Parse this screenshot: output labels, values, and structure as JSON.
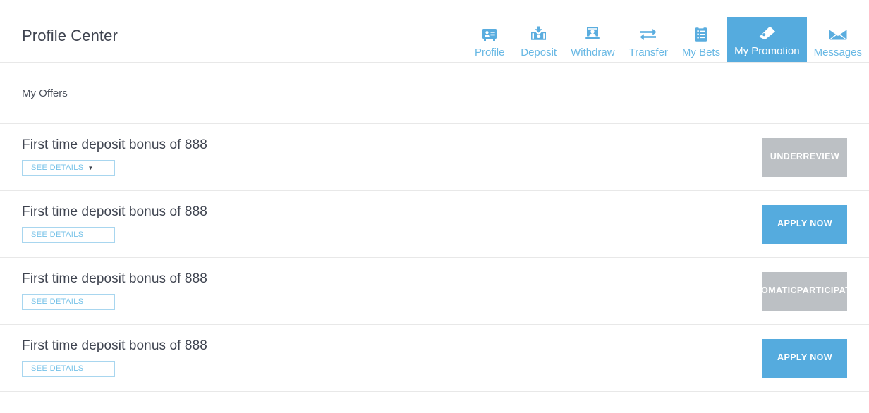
{
  "header": {
    "title": "Profile Center",
    "nav_items": [
      {
        "label": "Profile",
        "icon": "id-card-icon",
        "active": false
      },
      {
        "label": "Deposit",
        "icon": "deposit-icon",
        "active": false
      },
      {
        "label": "Withdraw",
        "icon": "withdraw-icon",
        "active": false
      },
      {
        "label": "Transfer",
        "icon": "transfer-icon",
        "active": false
      },
      {
        "label": "My Bets",
        "icon": "list-icon",
        "active": false
      },
      {
        "label": "My Promotion",
        "icon": "tag-icon",
        "active": true
      },
      {
        "label": "Messages",
        "icon": "envelope-icon",
        "active": false
      }
    ]
  },
  "subheader": {
    "title": "My Offers"
  },
  "offers": [
    {
      "title": "First time deposit bonus of 888",
      "details_label": "SEE DETAILS",
      "details_caret": "▼",
      "has_caret": true,
      "action_label": "UNDER REVIEW",
      "action_lines": [
        "UNDER",
        "REVIEW"
      ],
      "action_state": "disabled"
    },
    {
      "title": "First time deposit bonus of 888",
      "details_label": "SEE DETAILS",
      "details_caret": "",
      "has_caret": false,
      "action_label": "APPLY NOW",
      "action_lines": [
        "APPLY NOW"
      ],
      "action_state": "primary"
    },
    {
      "title": "First time deposit bonus of 888",
      "details_label": "SEE DETAILS",
      "details_caret": "",
      "has_caret": false,
      "action_label": "AUTOMATIC PARTICIPATION",
      "action_lines": [
        "AUTOMATIC",
        "PARTICIPATION"
      ],
      "action_state": "disabled"
    },
    {
      "title": "First time deposit bonus of 888",
      "details_label": "SEE DETAILS",
      "details_caret": "",
      "has_caret": false,
      "action_label": "APPLY NOW",
      "action_lines": [
        "APPLY NOW"
      ],
      "action_state": "primary"
    }
  ],
  "colors": {
    "accent_blue": "#55abde",
    "icon_blue": "#5aaddf",
    "label_blue": "#68b8e4",
    "disabled_gray": "#bcc0c4",
    "border_light": "#e8e8e8",
    "outline_blue": "#a8d6ef",
    "text_dark": "#3f4450"
  }
}
